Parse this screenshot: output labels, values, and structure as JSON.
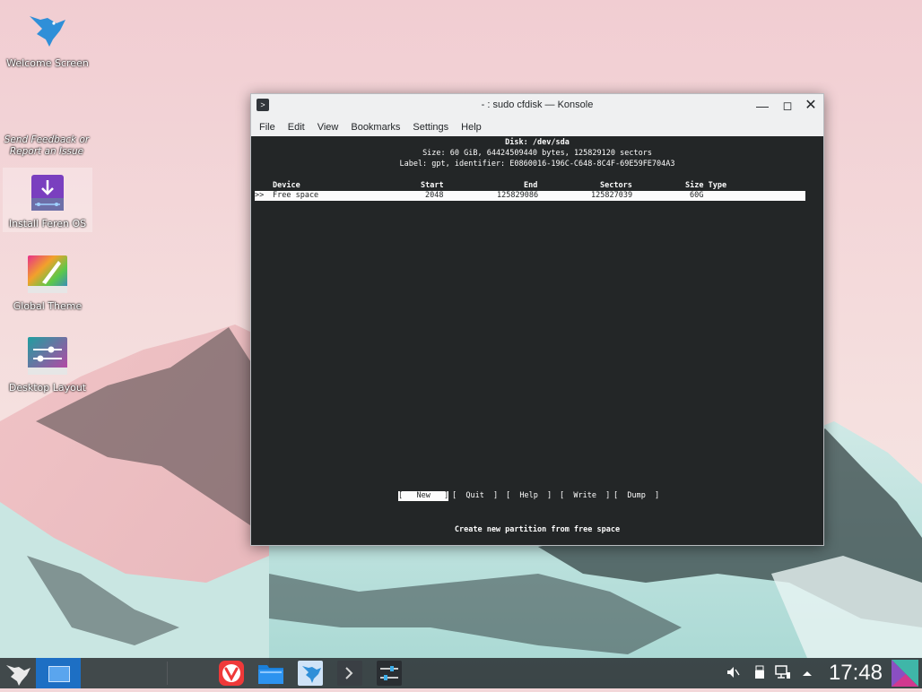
{
  "desktop": {
    "icons": [
      {
        "label": "Welcome Screen"
      },
      {
        "label": "Install Feren OS"
      },
      {
        "label": "Global Theme"
      },
      {
        "label": "Desktop Layout"
      }
    ],
    "feedback_text": "Send Feedback or Report an Issue"
  },
  "window": {
    "title": "- : sudo cfdisk — Konsole",
    "menu": [
      "File",
      "Edit",
      "View",
      "Bookmarks",
      "Settings",
      "Help"
    ]
  },
  "cfdisk": {
    "disk_line": "Disk: /dev/sda",
    "size_line": "Size: 60 GiB, 64424509440 bytes, 125829120 sectors",
    "label_line": "Label: gpt, identifier: E0860016-196C-C648-8C4F-69E59FE704A3",
    "columns": {
      "device": "Device",
      "start": "Start",
      "end": "End",
      "sectors": "Sectors",
      "size_type": "Size Type"
    },
    "row": {
      "marker": ">>",
      "device": "Free space",
      "start": "2048",
      "end": "125829086",
      "sectors": "125827039",
      "size": "60G"
    },
    "actions": [
      "[   New   ]",
      "[  Quit  ]",
      "[  Help  ]",
      "[  Write  ]",
      "[  Dump  ]"
    ],
    "active_action_index": 0,
    "hint": "Create new partition from free space"
  },
  "taskbar": {
    "clock": "17:48",
    "apps": [
      "launcher-icon",
      "show-desktop",
      "vivaldi-icon",
      "files-icon",
      "store-icon",
      "konsole-icon",
      "settings-icon"
    ]
  }
}
